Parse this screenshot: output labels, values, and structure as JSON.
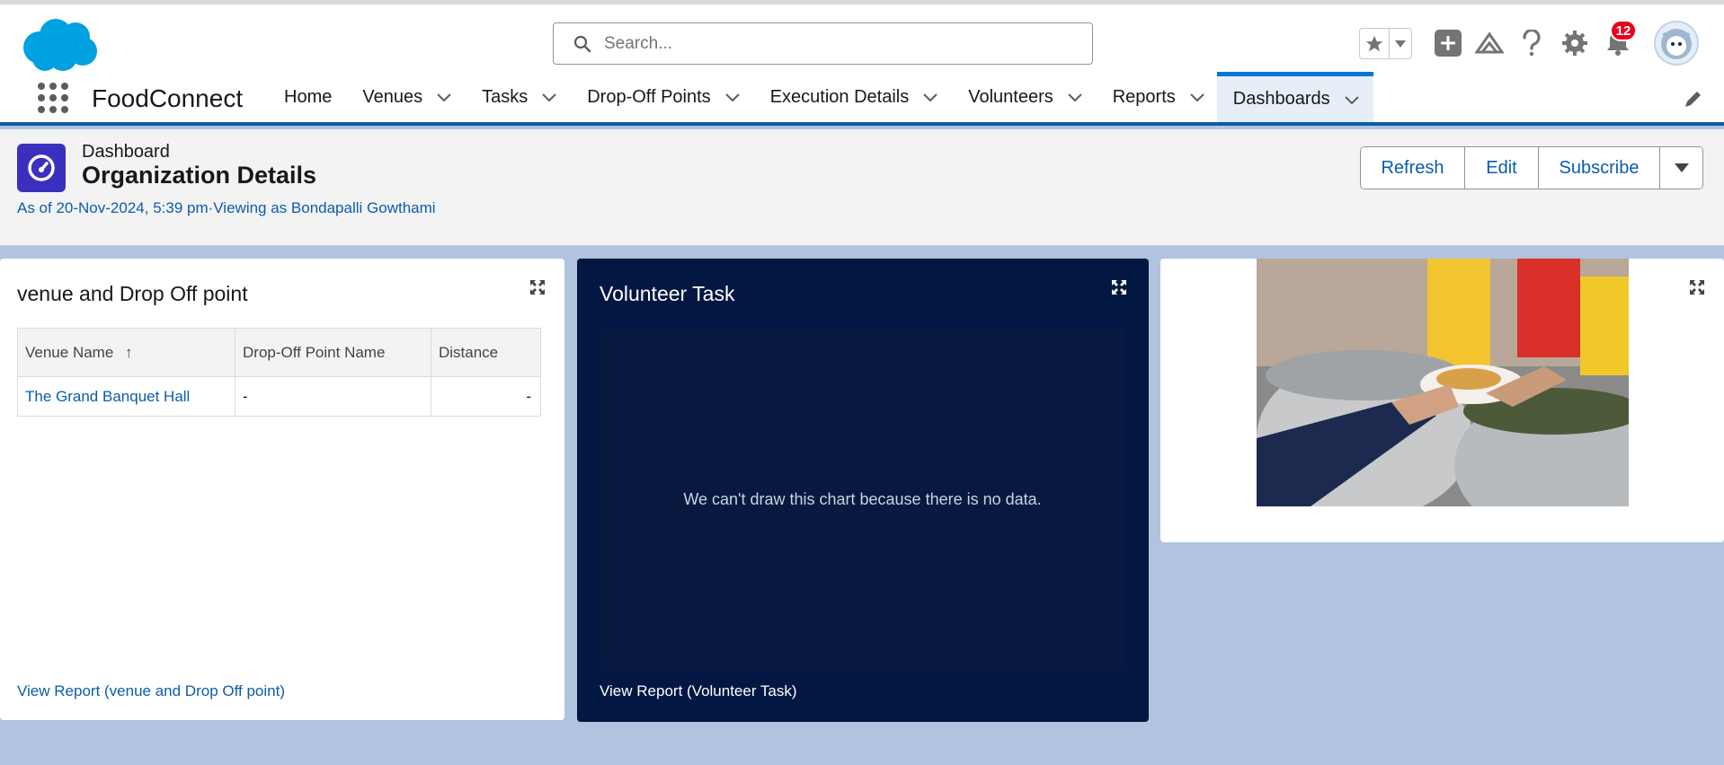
{
  "header": {
    "search_placeholder": "Search...",
    "notification_count": "12"
  },
  "nav": {
    "app_name": "FoodConnect",
    "items": [
      {
        "label": "Home"
      },
      {
        "label": "Venues"
      },
      {
        "label": "Tasks"
      },
      {
        "label": "Drop-Off Points"
      },
      {
        "label": "Execution Details"
      },
      {
        "label": "Volunteers"
      },
      {
        "label": "Reports"
      },
      {
        "label": "Dashboards"
      }
    ]
  },
  "dashboard": {
    "type_label": "Dashboard",
    "title": "Organization Details",
    "meta": "As of 20-Nov-2024, 5:39 pm·Viewing as Bondapalli Gowthami",
    "buttons": {
      "refresh": "Refresh",
      "edit": "Edit",
      "subscribe": "Subscribe"
    }
  },
  "widgets": {
    "venue": {
      "title": "venue and Drop Off point",
      "columns": [
        "Venue Name",
        "Drop-Off Point Name",
        "Distance"
      ],
      "sort_indicator": "↑",
      "rows": [
        {
          "venue": "The Grand Banquet Hall",
          "dropoff": "-",
          "distance": "-"
        }
      ],
      "view_report": "View Report (venue and Drop Off point)"
    },
    "volunteer": {
      "title": "Volunteer Task",
      "empty_message": "We can't draw this chart because there is no data.",
      "view_report": "View Report (Volunteer Task)"
    }
  },
  "colors": {
    "brand": "#0176d3",
    "link": "#0b5cab",
    "dashboard_bg": "#b0c4df",
    "dark_widget": "#021842",
    "badge": "#ea001e"
  }
}
